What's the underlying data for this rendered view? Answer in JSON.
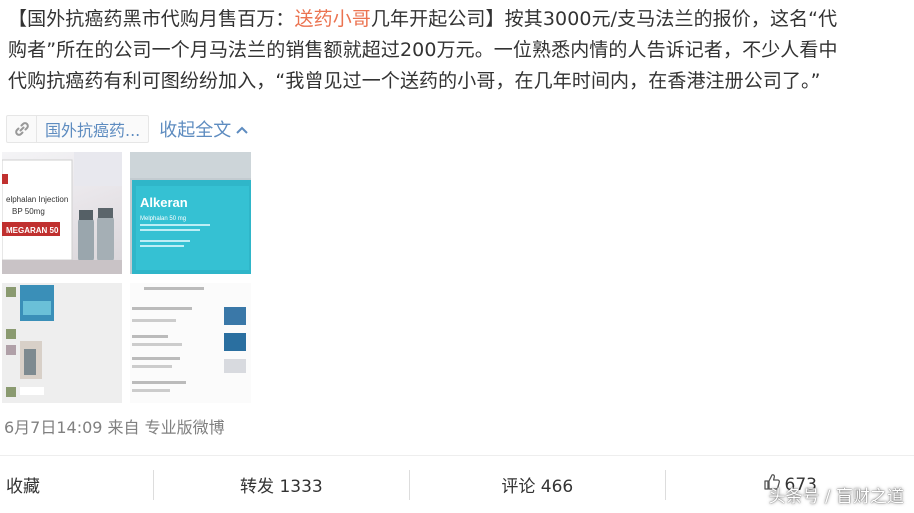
{
  "post": {
    "line1_a": "【国外抗癌药黑市代购月售百万：",
    "line1_highlight": "送药小哥",
    "line1_b": "几年开起公司】按其3000元/支马法兰的报价，这名“代",
    "line2": "购者”所在的公司一个月马法兰的销售额就超过200万元。一位熟悉内情的人告诉记者，不少人看中",
    "line3": "代购抗癌药有利可图纷纷加入，“我曾见过一个送药的小哥，在几年时间内，在香港注册公司了。”"
  },
  "link": {
    "icon": "link-icon",
    "label": "国外抗癌药...",
    "collapse_label": "收起全文",
    "collapse_icon": "chevron-up-icon"
  },
  "photos": {
    "photo1": {
      "label_top": "elphalan Injection",
      "label_mid": "BP 50mg",
      "label_brand": "MEGARAN 50"
    },
    "photo2": {
      "brand": "Alkeran",
      "sub": "Melphalan 50 mg"
    }
  },
  "meta": {
    "text": "6月7日14:09 来自 专业版微博"
  },
  "actions": {
    "favorite": "收藏",
    "repost": "转发 1333",
    "comment": "评论 466",
    "like": "673",
    "like_icon": "thumbs-up-icon"
  },
  "watermark": "头条号 / 盲财之道",
  "colors": {
    "highlight": "#eb7350",
    "link": "#5e8cc0",
    "meta": "#808080"
  }
}
